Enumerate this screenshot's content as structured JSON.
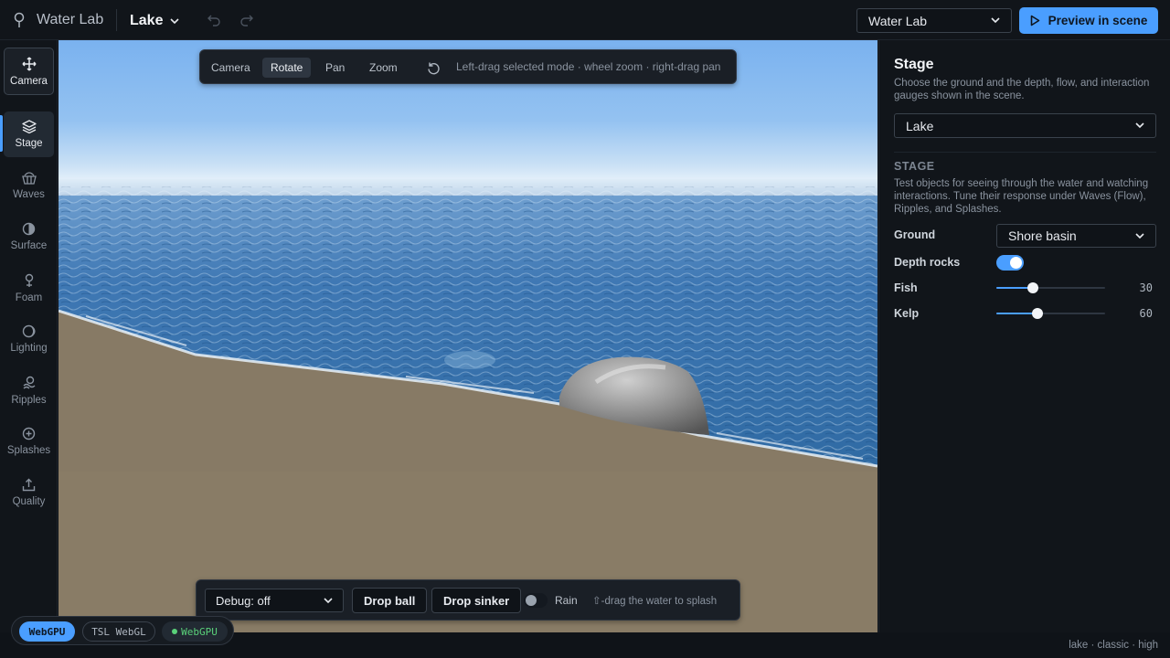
{
  "header": {
    "app_title": "Water Lab",
    "preset": "Lake",
    "project_select": "Water Lab",
    "preview_label": "Preview in scene"
  },
  "rail": {
    "items": [
      {
        "label": "Camera",
        "icon": "move-arrows-icon"
      },
      {
        "label": "Stage",
        "icon": "layers-icon"
      },
      {
        "label": "Waves",
        "icon": "wave-basket-icon"
      },
      {
        "label": "Surface",
        "icon": "half-circle-icon"
      },
      {
        "label": "Foam",
        "icon": "bubble-icon"
      },
      {
        "label": "Lighting",
        "icon": "moon-icon"
      },
      {
        "label": "Ripples",
        "icon": "ripple-icon"
      },
      {
        "label": "Splashes",
        "icon": "plus-circle-icon"
      },
      {
        "label": "Quality",
        "icon": "upload-icon"
      }
    ],
    "active": "Stage"
  },
  "camera_toolbar": {
    "modes": [
      "Camera",
      "Rotate",
      "Pan",
      "Zoom"
    ],
    "active_mode": "Rotate",
    "hint": "Left-drag selected mode · wheel zoom · right-drag pan"
  },
  "bottom_bar": {
    "debug_select": "Debug: off",
    "drop_ball": "Drop ball",
    "drop_sinker": "Drop sinker",
    "rain_label": "Rain",
    "rain_on": false,
    "hint": "⇧-drag the water to splash"
  },
  "backend": {
    "chip_1": "WebGPU",
    "chip_2": "TSL WebGL",
    "chip_3": "WebGPU"
  },
  "panel": {
    "title": "Stage",
    "description": "Choose the ground and the depth, flow, and interaction gauges shown in the scene.",
    "stage_select": "Lake",
    "section_heading": "STAGE",
    "section_description": "Test objects for seeing through the water and watching interactions. Tune their response under Waves (Flow), Ripples, and Splashes.",
    "ground_label": "Ground",
    "ground_value": "Shore basin",
    "depth_rocks_label": "Depth rocks",
    "depth_rocks_on": true,
    "fish_label": "Fish",
    "fish_value": "30",
    "fish_fraction": 0.34,
    "kelp_label": "Kelp",
    "kelp_value": "60",
    "kelp_fraction": 0.38
  },
  "status_footer": "lake · classic · high",
  "colors": {
    "accent": "#4a9eff",
    "sand": "#877a65",
    "water": "#3f78b4",
    "sky": "#8fbdf0"
  }
}
